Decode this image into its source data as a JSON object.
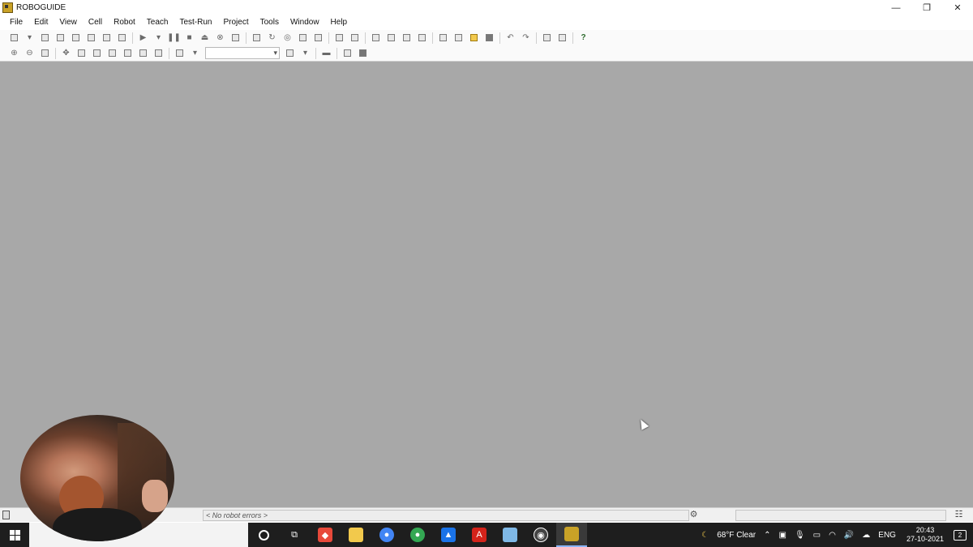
{
  "window": {
    "title": "ROBOGUIDE",
    "controls": {
      "minimize": "—",
      "restore": "❐",
      "close": "✕"
    }
  },
  "menu": [
    "File",
    "Edit",
    "View",
    "Cell",
    "Robot",
    "Teach",
    "Test-Run",
    "Project",
    "Tools",
    "Window",
    "Help"
  ],
  "status": {
    "robot_errors": "< No robot errors >"
  },
  "taskbar": {
    "weather": "68°F  Clear",
    "language": "ENG",
    "time": "20:43",
    "date": "27-10-2021",
    "notifications": "2",
    "app_colors": {
      "anydesk": "#e8493a",
      "explorer": "#f2c94c",
      "chrome": "#4285f4",
      "chrome2": "#34a853",
      "maps": "#1a73e8",
      "acrobat": "#d4231a",
      "rdp": "#7fb8e6",
      "obs": "#444444",
      "roboguide": "#c9a227"
    }
  }
}
